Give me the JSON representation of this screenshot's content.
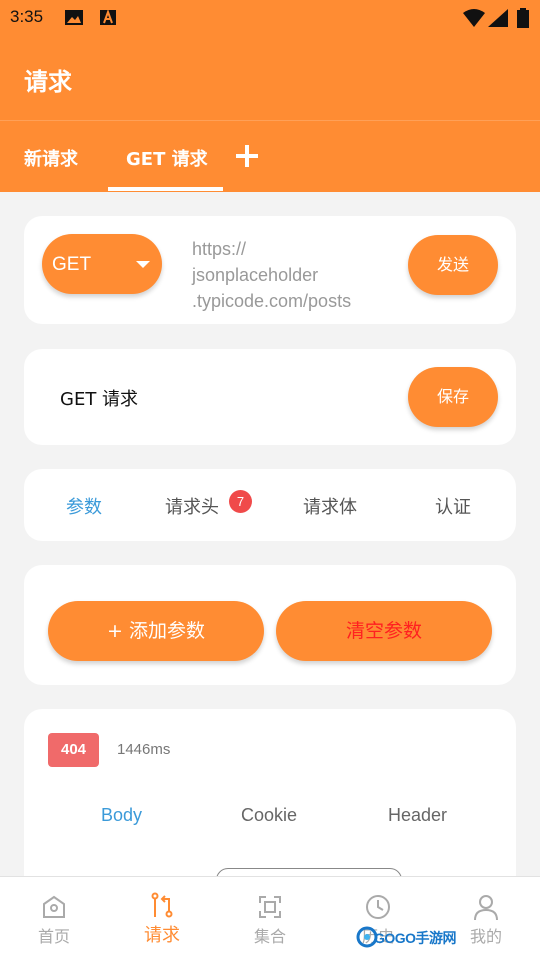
{
  "status_bar": {
    "time": "3:35",
    "icons": [
      "image-icon",
      "text-a-icon",
      "wifi-icon",
      "signal-icon",
      "battery-icon"
    ]
  },
  "app_bar": {
    "title": "请求"
  },
  "request_tabs": {
    "items": [
      {
        "label": "新请求",
        "active": false
      },
      {
        "label": "GET 请求",
        "active": true
      }
    ],
    "add_icon": "plus-icon"
  },
  "url_card": {
    "method": "GET",
    "url_lines": [
      "https://",
      "jsonplaceholder",
      ".typicode.com/posts"
    ],
    "send_label": "发送"
  },
  "name_card": {
    "request_name": "GET 请求",
    "save_label": "保存"
  },
  "section_tabs": {
    "items": [
      {
        "label": "参数",
        "active": true
      },
      {
        "label": "请求头",
        "badge": "7"
      },
      {
        "label": "请求体"
      },
      {
        "label": "认证"
      }
    ]
  },
  "params_card": {
    "add_label": "+ 添加参数",
    "clear_label": "清空参数"
  },
  "response_card": {
    "status_code": "404",
    "time": "1446ms",
    "tabs": [
      {
        "label": "Body",
        "active": true
      },
      {
        "label": "Cookie"
      },
      {
        "label": "Header"
      }
    ]
  },
  "bottom_nav": {
    "items": [
      {
        "label": "首页",
        "icon": "home-icon"
      },
      {
        "label": "请求",
        "icon": "request-icon",
        "active": true
      },
      {
        "label": "集合",
        "icon": "collection-icon"
      },
      {
        "label": "历史",
        "icon": "history-icon"
      },
      {
        "label": "我的",
        "icon": "user-icon"
      }
    ]
  },
  "watermark": {
    "text": "GOGO手游网"
  },
  "colors": {
    "accent": "#ff8c33",
    "active_blue": "#3b9ad9",
    "danger": "#ff2020",
    "badge": "#f04a4a",
    "status_404": "#f06a6a"
  }
}
